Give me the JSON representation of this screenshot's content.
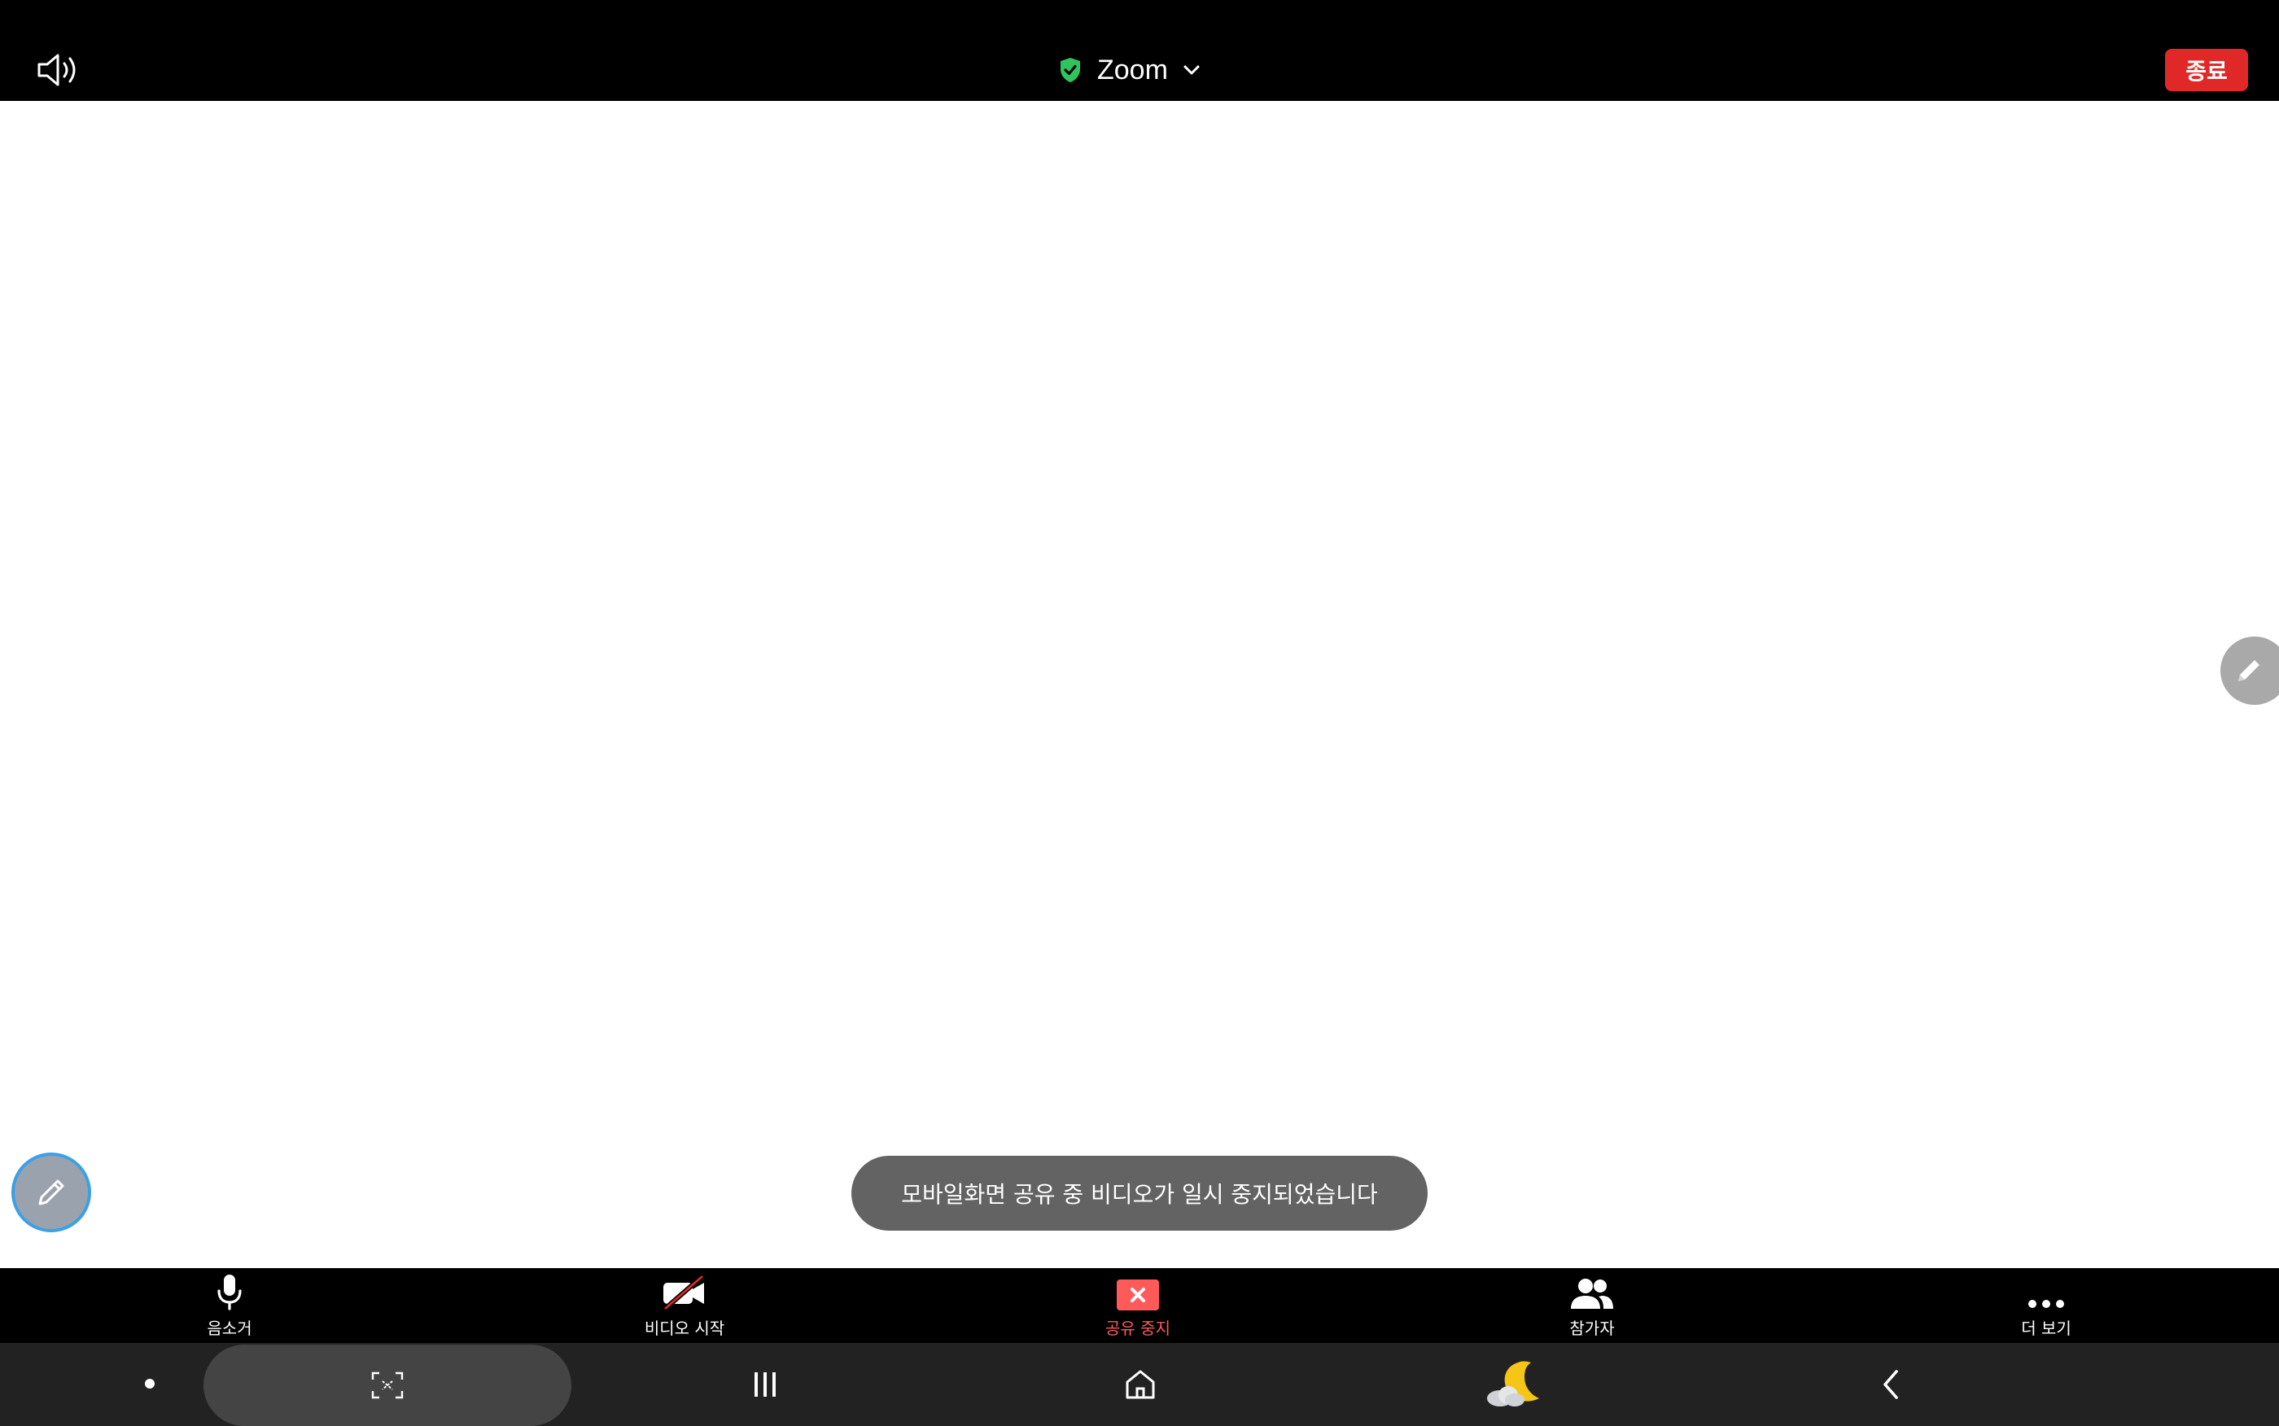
{
  "topbar": {
    "speaker_icon": "speaker-icon",
    "title": "Zoom",
    "shield_icon": "shield-check-icon",
    "chevron_icon": "chevron-down-icon",
    "end_label": "종료",
    "end_color": "#e02828",
    "shield_color": "#2ec55e"
  },
  "share": {
    "toast": "모바일화면 공유 중 비디오가 일시 중지되었습니다",
    "annotate_icon": "pencil-icon"
  },
  "toolbar": {
    "mute_label": "음소거",
    "video_label": "비디오 시작",
    "stop_share_label": "공유 중지",
    "participants_label": "참가자",
    "more_label": "더 보기",
    "stop_share_color": "#ff5a5a"
  },
  "navbar": {
    "capture_icon": "screen-capture-icon",
    "recents_icon": "recents-icon",
    "home_icon": "home-icon",
    "night_icon": "moon-cloud-icon",
    "back_icon": "back-icon"
  }
}
